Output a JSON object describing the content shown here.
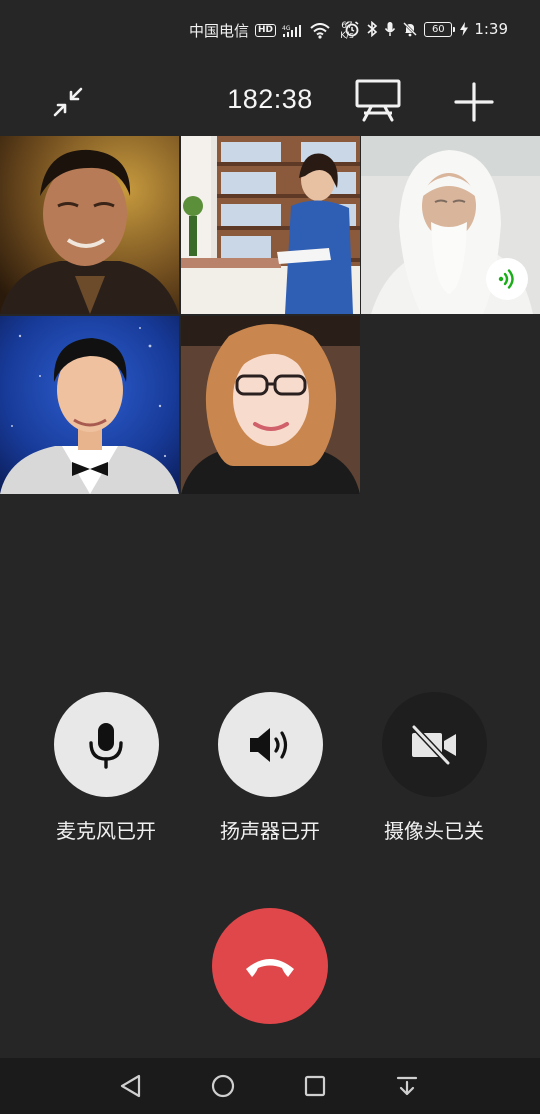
{
  "status_bar": {
    "carrier": "中国电信",
    "hd_badge": "HD",
    "network_type": "4G",
    "net_speed_value": "67",
    "net_speed_unit": "K/s",
    "battery_level": "60",
    "time": "1:39",
    "icons": [
      "signal-icon",
      "wifi-icon",
      "alarm-icon",
      "bluetooth-icon",
      "mic-status-icon",
      "mute-icon",
      "battery-icon",
      "charging-icon"
    ]
  },
  "call": {
    "duration": "182:38",
    "header_icons": [
      "minimize-icon",
      "screen-share-icon",
      "add-participant-icon"
    ]
  },
  "participants": [
    {
      "id": "p1",
      "speaking": false
    },
    {
      "id": "p2",
      "speaking": false
    },
    {
      "id": "p3",
      "speaking": true
    },
    {
      "id": "p4",
      "speaking": false
    },
    {
      "id": "p5",
      "speaking": false
    }
  ],
  "controls": {
    "mic": {
      "label": "麦克风已开",
      "icon": "microphone-icon",
      "state": "on"
    },
    "speaker": {
      "label": "扬声器已开",
      "icon": "speaker-icon",
      "state": "on"
    },
    "camera": {
      "label": "摄像头已关",
      "icon": "camera-off-icon",
      "state": "off"
    }
  },
  "hangup": {
    "icon": "hang-up-icon"
  },
  "colors": {
    "background": "#262626",
    "hangup_red": "#e0474a",
    "control_on": "#e8e8e8",
    "control_off": "#1e1e1e",
    "speaking_green": "#1aad19"
  },
  "nav_bar": {
    "icons": [
      "back-icon",
      "home-icon",
      "recent-apps-icon",
      "notification-pull-icon"
    ]
  }
}
